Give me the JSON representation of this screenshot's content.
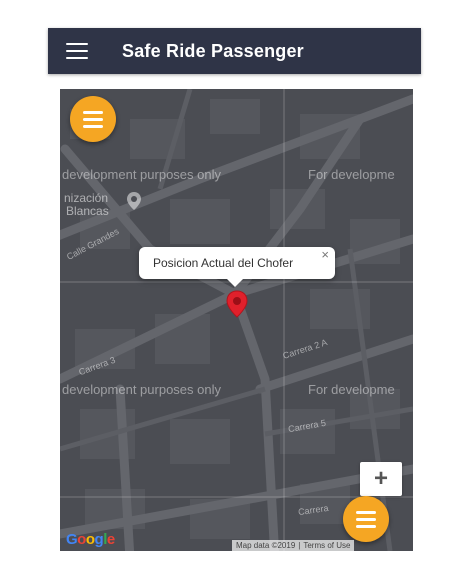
{
  "app_bar": {
    "title": "Safe Ride Passenger",
    "menu_icon": "hamburger-menu-icon",
    "background": "#2f3447"
  },
  "map": {
    "watermark_text": "development purposes only",
    "watermark_text_right": "For developme",
    "place_label_line1": "nización",
    "place_label_line2": "Blancas",
    "streets": {
      "calle_grandes": "Calle Grandes",
      "carrera_3": "Carrera 3",
      "carrera_2a": "Carrera 2 A",
      "carrera_5": "Carrera 5",
      "carrera_bottom": "Carrera"
    },
    "info_window": {
      "text": "Posicion Actual del Chofer",
      "close": "×"
    },
    "zoom_in_label": "+",
    "google_logo": "Google",
    "attribution": {
      "map_data": "Map data ©2019",
      "terms": "Terms of Use"
    },
    "fab_color": "#f5a623",
    "pin_color": "#e0202b"
  }
}
